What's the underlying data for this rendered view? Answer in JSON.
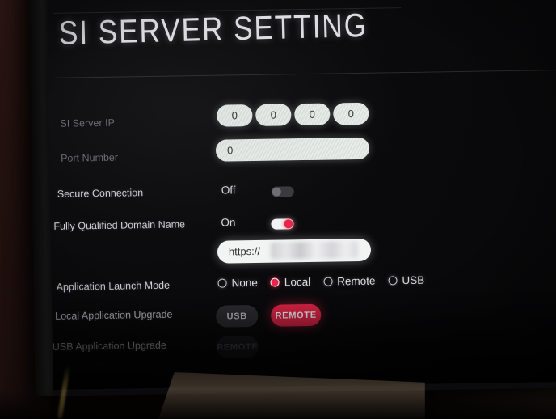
{
  "screen": {
    "title": "SI SERVER SETTING",
    "accent_red": "#e8264a",
    "field_white": "#e9ecea",
    "background": "#0a0a0c"
  },
  "rows": [
    {
      "label": "SI Server IP",
      "type": "ip",
      "octets": [
        "0",
        "0",
        "0",
        "0"
      ]
    },
    {
      "label": "Port Number",
      "type": "text",
      "value": "0"
    },
    {
      "label": "Secure Connection",
      "type": "toggle",
      "value": "Off",
      "state": "off"
    },
    {
      "label": "Fully Qualified Domain Name",
      "type": "toggle",
      "value": "On",
      "state": "on"
    },
    {
      "label": "",
      "type": "url",
      "value": "https://",
      "redacted": true
    },
    {
      "label": "Application Launch Mode",
      "type": "radio",
      "options": [
        "None",
        "Local",
        "Remote",
        "USB"
      ],
      "selected": "Local"
    },
    {
      "label": "Local Application Upgrade",
      "type": "buttons",
      "buttons": [
        "USB",
        "REMOTE"
      ],
      "active": "REMOTE"
    },
    {
      "label": "USB Application Upgrade",
      "type": "buttons",
      "buttons": [
        "REMOTE"
      ],
      "active": ""
    }
  ],
  "ip": {
    "octet_1": "0",
    "octet_2": "0",
    "octet_3": "0",
    "octet_4": "0"
  },
  "port": {
    "value": "0"
  },
  "secure_connection": {
    "label": "Secure Connection",
    "value": "Off"
  },
  "fqdn": {
    "label": "Fully Qualified Domain Name",
    "value": "On",
    "url": "https://"
  },
  "launch_mode": {
    "label": "Application Launch Mode",
    "option_none": "None",
    "option_local": "Local",
    "option_remote": "Remote",
    "option_usb": "USB",
    "selected": "Local"
  },
  "local_upgrade": {
    "label": "Local Application Upgrade",
    "usb_label": "USB",
    "remote_label": "REMOTE"
  },
  "usb_upgrade": {
    "label": "USB Application Upgrade",
    "remote_label": "REMOTE"
  },
  "labels": {
    "si_server_ip": "SI Server IP",
    "port_number": "Port Number"
  }
}
